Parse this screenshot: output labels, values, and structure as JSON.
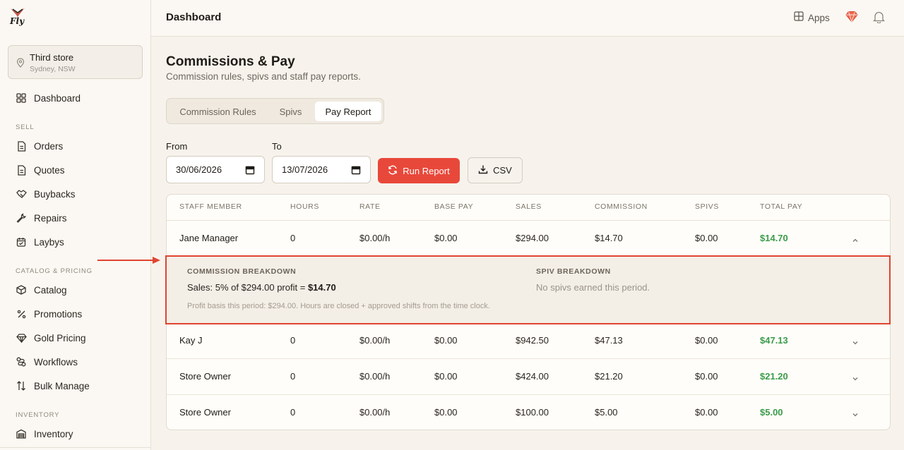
{
  "brand": {
    "logo_text": "Fly"
  },
  "store": {
    "name": "Third store",
    "location": "Sydney, NSW"
  },
  "sidebar": {
    "top_item": {
      "label": "Dashboard",
      "icon": "grid-icon"
    },
    "sections": [
      {
        "title": "SELL",
        "items": [
          {
            "label": "Orders",
            "icon": "document-icon"
          },
          {
            "label": "Quotes",
            "icon": "document-icon"
          },
          {
            "label": "Buybacks",
            "icon": "handshake-icon"
          },
          {
            "label": "Repairs",
            "icon": "wrench-icon"
          },
          {
            "label": "Laybys",
            "icon": "calendar-icon"
          }
        ]
      },
      {
        "title": "CATALOG & PRICING",
        "items": [
          {
            "label": "Catalog",
            "icon": "box-icon"
          },
          {
            "label": "Promotions",
            "icon": "percent-icon"
          },
          {
            "label": "Gold Pricing",
            "icon": "diamond-icon"
          },
          {
            "label": "Workflows",
            "icon": "workflow-icon"
          },
          {
            "label": "Bulk Manage",
            "icon": "sort-arrows-icon"
          }
        ]
      },
      {
        "title": "INVENTORY",
        "items": [
          {
            "label": "Inventory",
            "icon": "warehouse-icon"
          }
        ]
      }
    ]
  },
  "topbar": {
    "title": "Dashboard",
    "apps_label": "Apps"
  },
  "page": {
    "title": "Commissions & Pay",
    "subtitle": "Commission rules, spivs and staff pay reports."
  },
  "tabs": [
    {
      "label": "Commission Rules",
      "active": false
    },
    {
      "label": "Spivs",
      "active": false
    },
    {
      "label": "Pay Report",
      "active": true
    }
  ],
  "filters": {
    "from_label": "From",
    "from_value": "30/06/2026",
    "to_label": "To",
    "to_value": "13/07/2026",
    "run_label": "Run Report",
    "csv_label": "CSV"
  },
  "colors": {
    "accent": "#e8483a",
    "positive": "#3a9c4a",
    "background": "#f7f3ec"
  },
  "table": {
    "headers": [
      "STAFF MEMBER",
      "HOURS",
      "RATE",
      "BASE PAY",
      "SALES",
      "COMMISSION",
      "SPIVS",
      "TOTAL PAY"
    ],
    "rows": [
      {
        "name": "Jane Manager",
        "hours": "0",
        "rate": "$0.00/h",
        "base": "$0.00",
        "sales": "$294.00",
        "commission": "$14.70",
        "spivs": "$0.00",
        "total": "$14.70",
        "expanded": true
      },
      {
        "name": "Kay J",
        "hours": "0",
        "rate": "$0.00/h",
        "base": "$0.00",
        "sales": "$942.50",
        "commission": "$47.13",
        "spivs": "$0.00",
        "total": "$47.13",
        "expanded": false
      },
      {
        "name": "Store Owner",
        "hours": "0",
        "rate": "$0.00/h",
        "base": "$0.00",
        "sales": "$424.00",
        "commission": "$21.20",
        "spivs": "$0.00",
        "total": "$21.20",
        "expanded": false
      },
      {
        "name": "Store Owner",
        "hours": "0",
        "rate": "$0.00/h",
        "base": "$0.00",
        "sales": "$100.00",
        "commission": "$5.00",
        "spivs": "$0.00",
        "total": "$5.00",
        "expanded": false
      }
    ]
  },
  "breakdown": {
    "commission_title": "COMMISSION BREAKDOWN",
    "commission_line": "Sales: 5% of $294.00 profit =",
    "commission_value": "$14.70",
    "note": "Profit basis this period: $294.00. Hours are closed + approved shifts from the time clock.",
    "spiv_title": "SPIV BREAKDOWN",
    "spiv_empty": "No spivs earned this period."
  }
}
